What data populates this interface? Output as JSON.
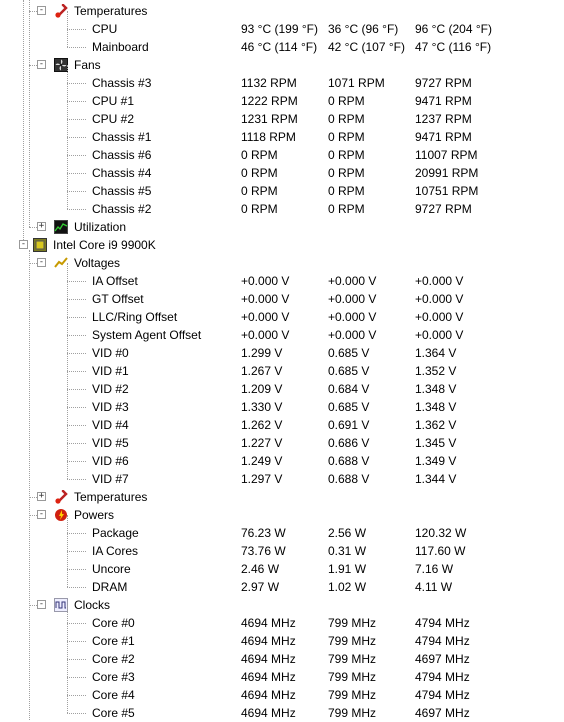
{
  "groups": [
    {
      "label": "Temperatures",
      "icon": "thermometer-icon",
      "expander": "-",
      "rows": [
        {
          "name": "CPU",
          "v1": "93 °C  (199 °F)",
          "v2": "36 °C  (96 °F)",
          "v3": "96 °C  (204 °F)"
        },
        {
          "name": "Mainboard",
          "v1": "46 °C  (114 °F)",
          "v2": "42 °C  (107 °F)",
          "v3": "47 °C  (116 °F)"
        }
      ]
    },
    {
      "label": "Fans",
      "icon": "fan-icon",
      "expander": "-",
      "rows": [
        {
          "name": "Chassis #3",
          "v1": "1132 RPM",
          "v2": "1071 RPM",
          "v3": "9727 RPM"
        },
        {
          "name": "CPU #1",
          "v1": "1222 RPM",
          "v2": "0 RPM",
          "v3": "9471 RPM"
        },
        {
          "name": "CPU #2",
          "v1": "1231 RPM",
          "v2": "0 RPM",
          "v3": "1237 RPM"
        },
        {
          "name": "Chassis #1",
          "v1": "1118 RPM",
          "v2": "0 RPM",
          "v3": "9471 RPM"
        },
        {
          "name": "Chassis #6",
          "v1": "0 RPM",
          "v2": "0 RPM",
          "v3": "11007 RPM"
        },
        {
          "name": "Chassis #4",
          "v1": "0 RPM",
          "v2": "0 RPM",
          "v3": "20991 RPM"
        },
        {
          "name": "Chassis #5",
          "v1": "0 RPM",
          "v2": "0 RPM",
          "v3": "10751 RPM"
        },
        {
          "name": "Chassis #2",
          "v1": "0 RPM",
          "v2": "0 RPM",
          "v3": "9727 RPM"
        }
      ]
    },
    {
      "label": "Utilization",
      "icon": "utilization-icon",
      "expander": "+",
      "rows": []
    }
  ],
  "cpu": {
    "label": "Intel Core i9 9900K",
    "icon": "cpu-chip-icon",
    "groups": [
      {
        "label": "Voltages",
        "icon": "voltage-icon",
        "expander": "-",
        "rows": [
          {
            "name": "IA Offset",
            "v1": "+0.000 V",
            "v2": "+0.000 V",
            "v3": "+0.000 V"
          },
          {
            "name": "GT Offset",
            "v1": "+0.000 V",
            "v2": "+0.000 V",
            "v3": "+0.000 V"
          },
          {
            "name": "LLC/Ring Offset",
            "v1": "+0.000 V",
            "v2": "+0.000 V",
            "v3": "+0.000 V"
          },
          {
            "name": "System Agent Offset",
            "v1": "+0.000 V",
            "v2": "+0.000 V",
            "v3": "+0.000 V"
          },
          {
            "name": "VID #0",
            "v1": "1.299 V",
            "v2": "0.685 V",
            "v3": "1.364 V"
          },
          {
            "name": "VID #1",
            "v1": "1.267 V",
            "v2": "0.685 V",
            "v3": "1.352 V"
          },
          {
            "name": "VID #2",
            "v1": "1.209 V",
            "v2": "0.684 V",
            "v3": "1.348 V"
          },
          {
            "name": "VID #3",
            "v1": "1.330 V",
            "v2": "0.685 V",
            "v3": "1.348 V"
          },
          {
            "name": "VID #4",
            "v1": "1.262 V",
            "v2": "0.691 V",
            "v3": "1.362 V"
          },
          {
            "name": "VID #5",
            "v1": "1.227 V",
            "v2": "0.686 V",
            "v3": "1.345 V"
          },
          {
            "name": "VID #6",
            "v1": "1.249 V",
            "v2": "0.688 V",
            "v3": "1.349 V"
          },
          {
            "name": "VID #7",
            "v1": "1.297 V",
            "v2": "0.688 V",
            "v3": "1.344 V"
          }
        ]
      },
      {
        "label": "Temperatures",
        "icon": "thermometer-icon",
        "expander": "+",
        "rows": []
      },
      {
        "label": "Powers",
        "icon": "power-icon",
        "expander": "-",
        "rows": [
          {
            "name": "Package",
            "v1": "76.23 W",
            "v2": "2.56 W",
            "v3": "120.32 W"
          },
          {
            "name": "IA Cores",
            "v1": "73.76 W",
            "v2": "0.31 W",
            "v3": "117.60 W"
          },
          {
            "name": "Uncore",
            "v1": "2.46 W",
            "v2": "1.91 W",
            "v3": "7.16 W"
          },
          {
            "name": "DRAM",
            "v1": "2.97 W",
            "v2": "1.02 W",
            "v3": "4.11 W"
          }
        ]
      },
      {
        "label": "Clocks",
        "icon": "clock-wave-icon",
        "expander": "-",
        "rows": [
          {
            "name": "Core #0",
            "v1": "4694 MHz",
            "v2": "799 MHz",
            "v3": "4794 MHz"
          },
          {
            "name": "Core #1",
            "v1": "4694 MHz",
            "v2": "799 MHz",
            "v3": "4794 MHz"
          },
          {
            "name": "Core #2",
            "v1": "4694 MHz",
            "v2": "799 MHz",
            "v3": "4697 MHz"
          },
          {
            "name": "Core #3",
            "v1": "4694 MHz",
            "v2": "799 MHz",
            "v3": "4794 MHz"
          },
          {
            "name": "Core #4",
            "v1": "4694 MHz",
            "v2": "799 MHz",
            "v3": "4794 MHz"
          },
          {
            "name": "Core #5",
            "v1": "4694 MHz",
            "v2": "799 MHz",
            "v3": "4697 MHz"
          }
        ]
      }
    ]
  }
}
